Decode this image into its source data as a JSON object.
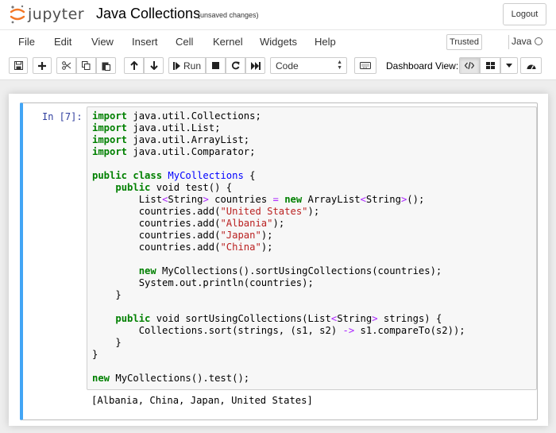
{
  "header": {
    "logo_text": "jupyter",
    "notebook_title": "Java Collections",
    "save_status": "(unsaved changes)",
    "logout_label": "Logout"
  },
  "menubar": {
    "items": [
      "File",
      "Edit",
      "View",
      "Insert",
      "Cell",
      "Kernel",
      "Widgets",
      "Help"
    ],
    "trusted_label": "Trusted",
    "kernel_name": "Java"
  },
  "toolbar": {
    "run_label": "Run",
    "cell_type_value": "Code",
    "dashboard_label": "Dashboard View:",
    "icons": [
      "save-icon",
      "add-cell-icon",
      "cut-icon",
      "copy-icon",
      "paste-icon",
      "move-up-icon",
      "move-down-icon",
      "run-icon",
      "stop-icon",
      "restart-icon",
      "fast-forward-icon",
      "keyboard-icon",
      "code-view-icon",
      "grid-view-icon",
      "caret-down-icon",
      "dashboard-icon"
    ]
  },
  "cell": {
    "prompt": "In [7]:",
    "code_lines": [
      [
        [
          "kw",
          "import"
        ],
        [
          "t",
          " java.util.Collections;"
        ]
      ],
      [
        [
          "kw",
          "import"
        ],
        [
          "t",
          " java.util.List;"
        ]
      ],
      [
        [
          "kw",
          "import"
        ],
        [
          "t",
          " java.util.ArrayList;"
        ]
      ],
      [
        [
          "kw",
          "import"
        ],
        [
          "t",
          " java.util.Comparator;"
        ]
      ],
      [],
      [
        [
          "kw",
          "public"
        ],
        [
          "t",
          " "
        ],
        [
          "kw",
          "class"
        ],
        [
          "t",
          " "
        ],
        [
          "cls",
          "MyCollections"
        ],
        [
          "t",
          " {"
        ]
      ],
      [
        [
          "t",
          "    "
        ],
        [
          "kw",
          "public"
        ],
        [
          "t",
          " void test() {"
        ]
      ],
      [
        [
          "t",
          "        List"
        ],
        [
          "op",
          "<"
        ],
        [
          "t",
          "String"
        ],
        [
          "op",
          ">"
        ],
        [
          "t",
          " countries "
        ],
        [
          "op",
          "="
        ],
        [
          "t",
          " "
        ],
        [
          "kw",
          "new"
        ],
        [
          "t",
          " ArrayList"
        ],
        [
          "op",
          "<"
        ],
        [
          "t",
          "String"
        ],
        [
          "op",
          ">"
        ],
        [
          "t",
          "();"
        ]
      ],
      [
        [
          "t",
          "        countries.add("
        ],
        [
          "str",
          "\"United States\""
        ],
        [
          "t",
          ");"
        ]
      ],
      [
        [
          "t",
          "        countries.add("
        ],
        [
          "str",
          "\"Albania\""
        ],
        [
          "t",
          ");"
        ]
      ],
      [
        [
          "t",
          "        countries.add("
        ],
        [
          "str",
          "\"Japan\""
        ],
        [
          "t",
          ");"
        ]
      ],
      [
        [
          "t",
          "        countries.add("
        ],
        [
          "str",
          "\"China\""
        ],
        [
          "t",
          ");"
        ]
      ],
      [],
      [
        [
          "t",
          "        "
        ],
        [
          "kw",
          "new"
        ],
        [
          "t",
          " MyCollections().sortUsingCollections(countries);"
        ]
      ],
      [
        [
          "t",
          "        System.out.println(countries);"
        ]
      ],
      [
        [
          "t",
          "    }"
        ]
      ],
      [],
      [
        [
          "t",
          "    "
        ],
        [
          "kw",
          "public"
        ],
        [
          "t",
          " void sortUsingCollections(List"
        ],
        [
          "op",
          "<"
        ],
        [
          "t",
          "String"
        ],
        [
          "op",
          ">"
        ],
        [
          "t",
          " strings) {"
        ]
      ],
      [
        [
          "t",
          "        Collections.sort(strings, (s1, s2) "
        ],
        [
          "op",
          "->"
        ],
        [
          "t",
          " s1.compareTo(s2));"
        ]
      ],
      [
        [
          "t",
          "    }"
        ]
      ],
      [
        [
          "t",
          "}"
        ]
      ],
      [],
      [
        [
          "kw",
          "new"
        ],
        [
          "t",
          " MyCollections().test();"
        ]
      ]
    ],
    "output": "[Albania, China, Japan, United States]"
  },
  "colors": {
    "keyword": "#008000",
    "class_name": "#0000ff",
    "string": "#ba2121",
    "operator": "#aa22ff",
    "prompt": "#303f9f",
    "selected_cell_border": "#42a5f5",
    "logo_orange": "#f37726"
  }
}
